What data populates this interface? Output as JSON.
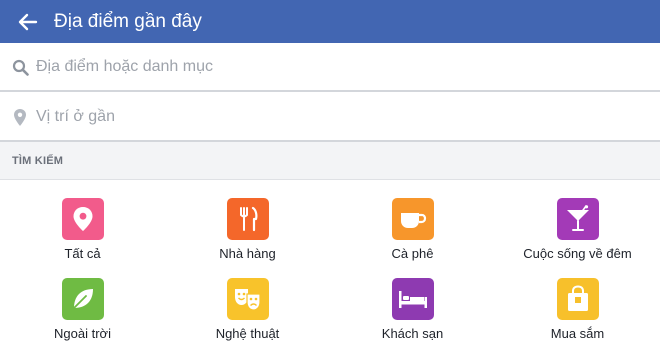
{
  "header": {
    "title": "Địa điểm gần đây",
    "back_icon": "arrow-left-icon",
    "bg_color": "#4266b2"
  },
  "search": {
    "placeholder": "Địa điểm hoặc danh mục",
    "value": "",
    "icon": "search-icon"
  },
  "location": {
    "placeholder": "Vị trí ở gần",
    "value": "",
    "icon": "map-pin-icon"
  },
  "section": {
    "title": "TÌM KIẾM"
  },
  "categories": [
    {
      "label": "Tất cả",
      "icon": "map-pin-icon",
      "color": "#f25b8b"
    },
    {
      "label": "Nhà hàng",
      "icon": "fork-knife-icon",
      "color": "#f4672a"
    },
    {
      "label": "Cà phê",
      "icon": "coffee-cup-icon",
      "color": "#f7962b"
    },
    {
      "label": "Cuộc sống về đêm",
      "icon": "cocktail-icon",
      "color": "#a33ab7"
    },
    {
      "label": "Ngoài trời",
      "icon": "leaf-icon",
      "color": "#6fbb43"
    },
    {
      "label": "Nghệ thuật",
      "icon": "theater-masks-icon",
      "color": "#f8c32b"
    },
    {
      "label": "Khách sạn",
      "icon": "bed-icon",
      "color": "#8e3ab1"
    },
    {
      "label": "Mua sắm",
      "icon": "shopping-bag-icon",
      "color": "#f7c02b"
    }
  ]
}
